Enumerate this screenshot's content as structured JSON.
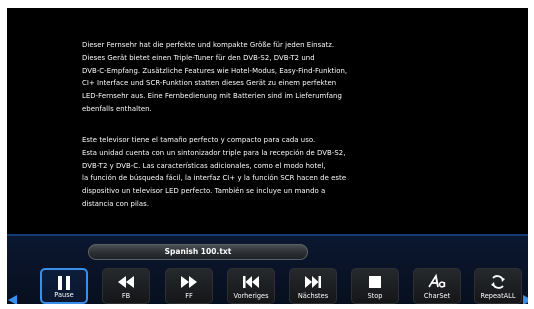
{
  "document": {
    "paragraph_de": [
      "Dieser Fernsehr hat die perfekte und kompakte Größe für jeden Einsatz.",
      "Dieses Gerät bietet einen Triple-Tuner für den DVB-S2, DVB-T2 und",
      "DVB-C-Empfang. Zusätzliche Features wie Hotel-Modus, Easy-Find-Funktion,",
      "CI+ Interface und SCR-Funktion statten dieses Gerät zu einem perfekten",
      "LED-Fernsehr aus. Eine Fernbedienung mit Batterien sind im Lieferumfang",
      "ebenfalls enthalten."
    ],
    "paragraph_es": [
      "Este televisor tiene el tamaño perfecto y compacto para cada uso.",
      "Esta unidad cuenta con un sintonizador triple para la recepción de DVB-S2,",
      "DVB-T2 y DVB-C. Las características adicionales, como el modo hotel,",
      "la función de búsqueda fácil, la interfaz CI+ y la función SCR hacen de este",
      "dispositivo un televisor LED perfecto. También se incluye un mando a",
      "distancia con pilas."
    ]
  },
  "player": {
    "filename": "Spanish 100.txt",
    "controls": [
      {
        "label": "Pause",
        "icon": "pause-icon",
        "active": true
      },
      {
        "label": "FB",
        "icon": "fast-backward-icon",
        "active": false
      },
      {
        "label": "FF",
        "icon": "fast-forward-icon",
        "active": false
      },
      {
        "label": "Vorheriges",
        "icon": "skip-previous-icon",
        "active": false
      },
      {
        "label": "Nächstes",
        "icon": "skip-next-icon",
        "active": false
      },
      {
        "label": "Stop",
        "icon": "stop-icon",
        "active": false
      },
      {
        "label": "CharSet",
        "icon": "charset-icon",
        "active": false
      },
      {
        "label": "RepeatALL",
        "icon": "repeat-icon",
        "active": false
      }
    ],
    "nav_left_icon": "arrow-left-icon",
    "nav_right_icon": "arrow-right-icon"
  },
  "colors": {
    "accent": "#3a8fe8",
    "background": "#000000",
    "text": "#ffffff"
  }
}
